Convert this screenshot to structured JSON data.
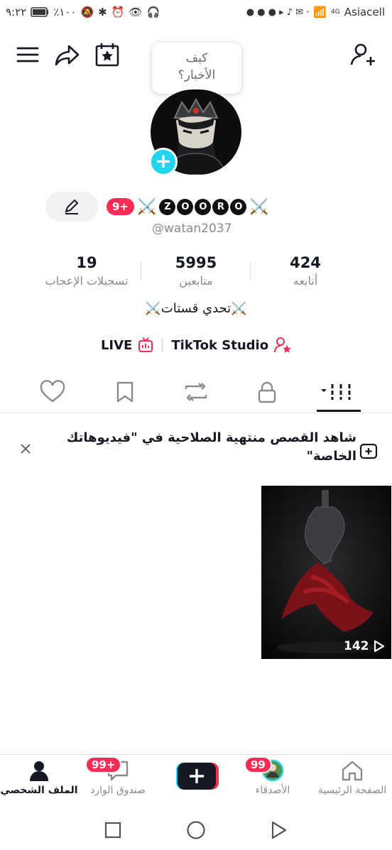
{
  "status_bar": {
    "time": "٩:٢٢",
    "battery": "٪١٠٠",
    "carrier": "Asiacell",
    "network": "4G"
  },
  "bubble": {
    "line1": "كيف",
    "line2": "الأخبار؟"
  },
  "profile": {
    "notif_badge": "9+",
    "display_name_letters": [
      "Z",
      "O",
      "O",
      "R",
      "O"
    ],
    "handle": "@watan2037",
    "bio": "⚔️تحدي قستات⚔️"
  },
  "stats": [
    {
      "number": "19",
      "label": "تسجيلات الإعجاب"
    },
    {
      "number": "5995",
      "label": "متابعين"
    },
    {
      "number": "424",
      "label": "أتابعه"
    }
  ],
  "links": {
    "live": "LIVE",
    "studio": "TikTok Studio"
  },
  "notice": {
    "text": "شاهد القصص منتهية الصلاحية في \"فيديوهاتك الخاصة\""
  },
  "video": {
    "views": "142"
  },
  "bottom_nav": [
    {
      "label": "الملف الشخصي",
      "active": true
    },
    {
      "label": "صندوق الوارد",
      "badge": "99+"
    },
    {
      "label": ""
    },
    {
      "label": "الأصدقاء",
      "badge": "99"
    },
    {
      "label": "الصفحة الرئيسية"
    }
  ],
  "colors": {
    "accent": "#fe2c55",
    "cyan": "#20d5ec",
    "text": "#161823",
    "muted": "#8a8b91"
  }
}
